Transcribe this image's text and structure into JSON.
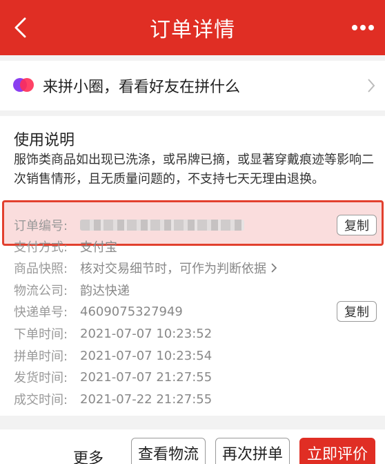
{
  "header": {
    "title": "订单详情"
  },
  "circle": {
    "text": "来拼小圈，看看好友在拼什么"
  },
  "instructions": {
    "title": "使用说明",
    "body": "服饰类商品如出现已洗涤，或吊牌已摘，或显著穿戴痕迹等影响二次销售情形，且无质量问题的，不支持七天无理由退换。"
  },
  "info": {
    "order_no_label": "订单编号:",
    "copy_label": "复制",
    "payment_label": "支付方式:",
    "payment_value": "支付宝",
    "snapshot_label": "商品快照:",
    "snapshot_value": "核对交易细节时，可作为判断依据",
    "logistics_label": "物流公司:",
    "logistics_value": "韵达快递",
    "tracking_label": "快递单号:",
    "tracking_value": "4609075327949",
    "order_time_label": "下单时间:",
    "order_time_value": "2021-07-07 10:23:52",
    "group_time_label": "拼单时间:",
    "group_time_value": "2021-07-07 10:23:54",
    "ship_time_label": "发货时间:",
    "ship_time_value": "2021-07-07 21:27:55",
    "deal_time_label": "成交时间:",
    "deal_time_value": "2021-07-22 21:27:55"
  },
  "bottom": {
    "more": "更多",
    "view_logistics": "查看物流",
    "reorder": "再次拼单",
    "review": "立即评价"
  },
  "colors": {
    "brand": "#e02e24",
    "highlight_border": "#e2402e"
  }
}
